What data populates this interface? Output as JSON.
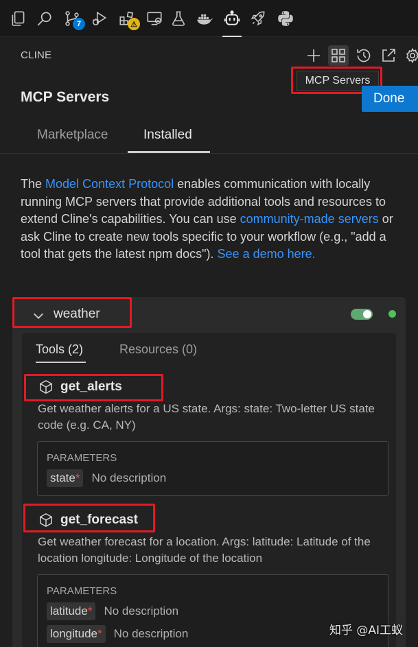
{
  "activity_bar": {
    "items": [
      {
        "name": "explorer-icon"
      },
      {
        "name": "search-icon"
      },
      {
        "name": "source-control-icon",
        "badge": "7"
      },
      {
        "name": "run-debug-icon"
      },
      {
        "name": "extensions-icon",
        "badge": "⚠"
      },
      {
        "name": "remote-explorer-icon"
      },
      {
        "name": "testing-icon"
      },
      {
        "name": "docker-icon"
      },
      {
        "name": "cline-icon",
        "active": true
      },
      {
        "name": "rocket-icon"
      },
      {
        "name": "python-icon"
      }
    ]
  },
  "header": {
    "title": "CLINE",
    "icons": [
      "plus-icon",
      "mcp-servers-icon",
      "history-icon",
      "popout-icon",
      "settings-icon"
    ]
  },
  "tooltip": {
    "text": "MCP Servers"
  },
  "page": {
    "title": "MCP Servers",
    "done_label": "Done"
  },
  "tabs": [
    {
      "label": "Marketplace",
      "active": false
    },
    {
      "label": "Installed",
      "active": true
    }
  ],
  "description": {
    "t1": "The ",
    "l1": "Model Context Protocol",
    "t2": " enables communication with locally running MCP servers that provide additional tools and resources to extend Cline's capabilities. You can use ",
    "l2": "community-made servers",
    "t3": " or ask Cline to create new tools specific to your workflow (e.g., \"add a tool that gets the latest npm docs\"). ",
    "l3": "See a demo here."
  },
  "server": {
    "name": "weather",
    "enabled": true,
    "status_color": "#4fc15a",
    "subtabs": [
      {
        "label": "Tools (2)",
        "active": true
      },
      {
        "label": "Resources (0)",
        "active": false
      }
    ],
    "tools": [
      {
        "name": "get_alerts",
        "description": "Get weather alerts for a US state. Args: state: Two-letter US state code (e.g. CA, NY)",
        "params_title": "PARAMETERS",
        "params": [
          {
            "name": "state",
            "required": "*",
            "description": "No description"
          }
        ]
      },
      {
        "name": "get_forecast",
        "description": "Get weather forecast for a location. Args: latitude: Latitude of the location longitude: Longitude of the location",
        "params_title": "PARAMETERS",
        "params": [
          {
            "name": "latitude",
            "required": "*",
            "description": "No description"
          },
          {
            "name": "longitude",
            "required": "*",
            "description": "No description"
          }
        ]
      }
    ]
  },
  "watermark": "知乎 @AI工蚁",
  "colors": {
    "accent": "#0e78d0",
    "link": "#3794ff",
    "highlight_box": "#e01b24",
    "toggle_on": "#5fa872"
  }
}
